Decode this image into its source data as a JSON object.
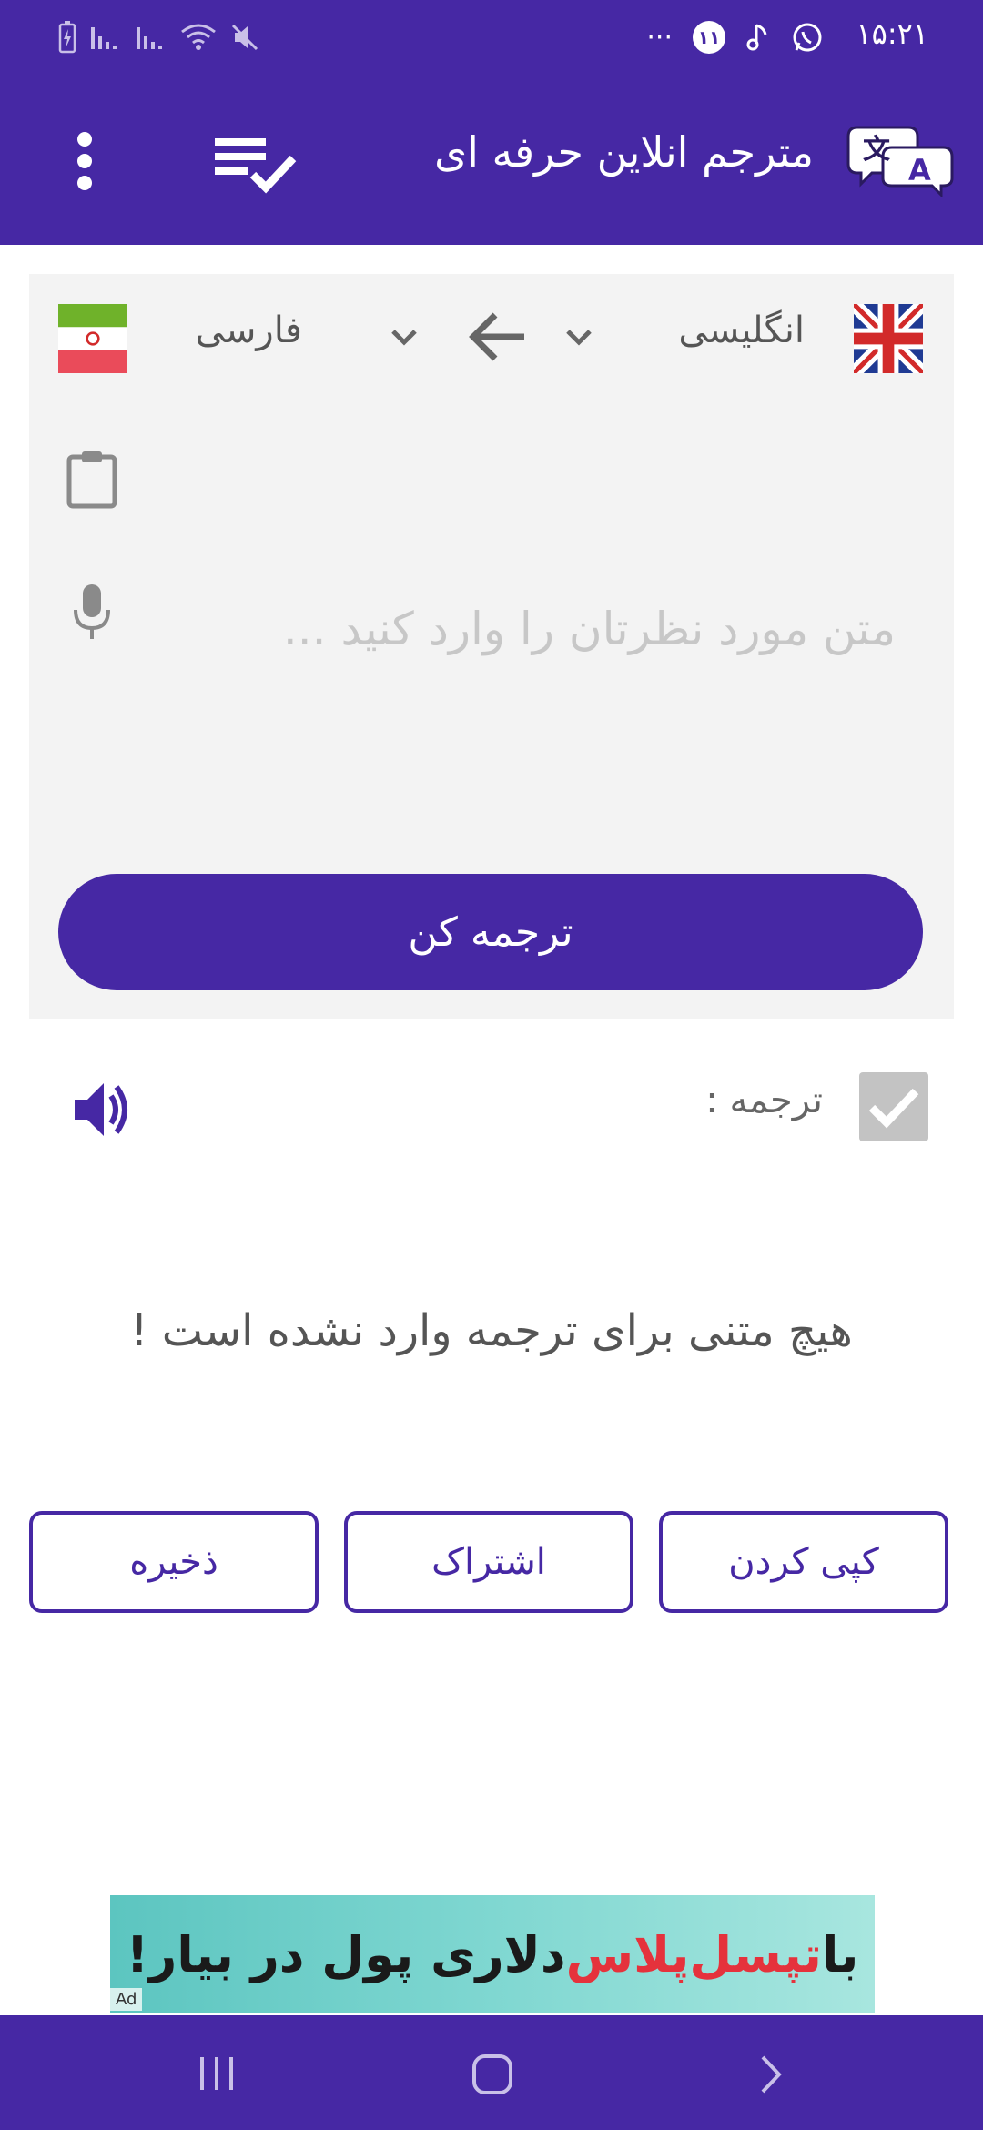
{
  "status_bar": {
    "time": "۱۵:۲۱",
    "notification_count": "۱۱",
    "more_dots": "···"
  },
  "app_bar": {
    "title": "مترجم انلاین حرفه ای"
  },
  "languages": {
    "source": "انگلیسی",
    "target": "فارسی"
  },
  "input": {
    "placeholder": "متن مورد نظرتان را وارد کنید ..."
  },
  "translate_button": "ترجمه کن",
  "result": {
    "label": "ترجمه :",
    "empty_message": "هیچ متنی برای ترجمه وارد نشده است !"
  },
  "actions": {
    "copy": "کپی کردن",
    "share": "اشتراک",
    "save": "ذخیره"
  },
  "ad": {
    "prefix": "با ",
    "brand": "تپسل‌پلاس",
    "suffix": " دلاری پول در بیار!",
    "tag": "Ad"
  },
  "colors": {
    "primary": "#4628a4",
    "card_bg": "#f3f3f3"
  },
  "icons": [
    "translate-logo-icon",
    "playlist-check-icon",
    "more-vert-icon",
    "uk-flag-icon",
    "iran-flag-icon",
    "chevron-down-icon",
    "arrow-left-icon",
    "clipboard-icon",
    "mic-icon",
    "check-icon",
    "volume-icon"
  ]
}
